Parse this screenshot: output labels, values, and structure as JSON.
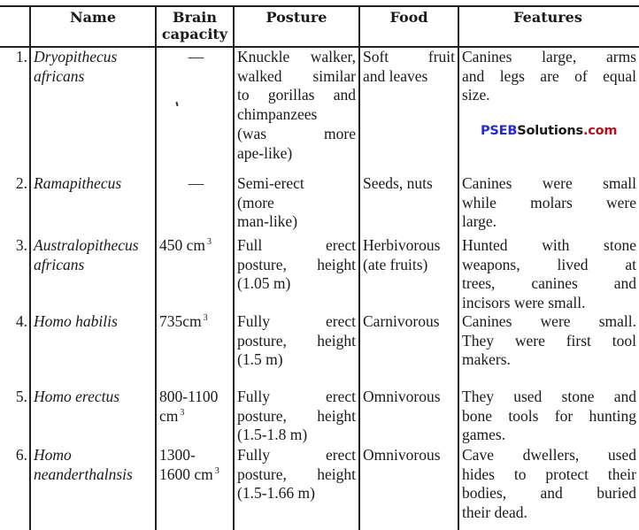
{
  "table": {
    "headers": {
      "num": "",
      "name": "Name",
      "brain_line1": "Brain",
      "brain_line2": "capacity",
      "posture": "Posture",
      "food": "Food",
      "features": "Features"
    },
    "rows": [
      {
        "num": "1.",
        "name": [
          "Dryopithecus",
          "africans"
        ],
        "brain": "—",
        "brain_sup": "",
        "posture": [
          "Knuckle walker,",
          "walked similar",
          "to gorillas and",
          "chimpanzees",
          "(was more",
          "ape-like)"
        ],
        "food": [
          "Soft fruit",
          "and leaves"
        ],
        "features": [
          "Canines large, arms",
          "and legs are of equal",
          "size."
        ]
      },
      {
        "num": "2.",
        "name": [
          "Ramapithecus"
        ],
        "brain": "—",
        "brain_sup": "",
        "posture": [
          "Semi-erect",
          "(more",
          "man-like)"
        ],
        "food": [
          "Seeds, nuts"
        ],
        "features": [
          "Canines were small",
          "while molars were",
          "large."
        ]
      },
      {
        "num": "3.",
        "name": [
          "Australopithecus",
          "africans"
        ],
        "brain": "450 cm",
        "brain_sup": "3",
        "posture": [
          "Full erect",
          "posture, height",
          "(1.05 m)"
        ],
        "food": [
          "Herbivorous",
          "(ate fruits)"
        ],
        "features": [
          "Hunted with stone",
          "weapons, lived at",
          "trees, canines and",
          "incisors were small."
        ]
      },
      {
        "num": "4.",
        "name": [
          "Homo habilis"
        ],
        "brain": "735cm",
        "brain_sup": "3",
        "posture": [
          "Fully erect",
          "posture, height",
          "(1.5 m)"
        ],
        "food": [
          "Carnivorous"
        ],
        "features": [
          "Canines were small.",
          "They were first tool",
          "makers."
        ]
      },
      {
        "num": "5.",
        "name": [
          "Homo erectus"
        ],
        "brain": [
          "800-1100",
          "cm"
        ],
        "brain_sup": "3",
        "posture": [
          "Fully erect",
          "posture, height",
          "(1.5-1.8 m)"
        ],
        "food": [
          "Omnivorous"
        ],
        "features": [
          "They used stone and",
          "bone tools for hunting",
          "games."
        ]
      },
      {
        "num": "6.",
        "name": [
          "Homo",
          "neanderthalnsis"
        ],
        "brain": [
          "1300-",
          "1600 cm"
        ],
        "brain_sup": "3",
        "posture": [
          "Fully erect",
          "posture, height",
          "(1.5-1.66 m)"
        ],
        "food": [
          "Omnivorous"
        ],
        "features": [
          "Cave dwellers, used",
          "hides to protect their",
          "bodies, and buried",
          "their dead."
        ]
      }
    ]
  },
  "watermark": {
    "part1": "PSEB",
    "part2": "Solutions",
    "part3": ".com",
    "color_part1": "#2a2ad4",
    "color_part3": "#b3121c"
  }
}
